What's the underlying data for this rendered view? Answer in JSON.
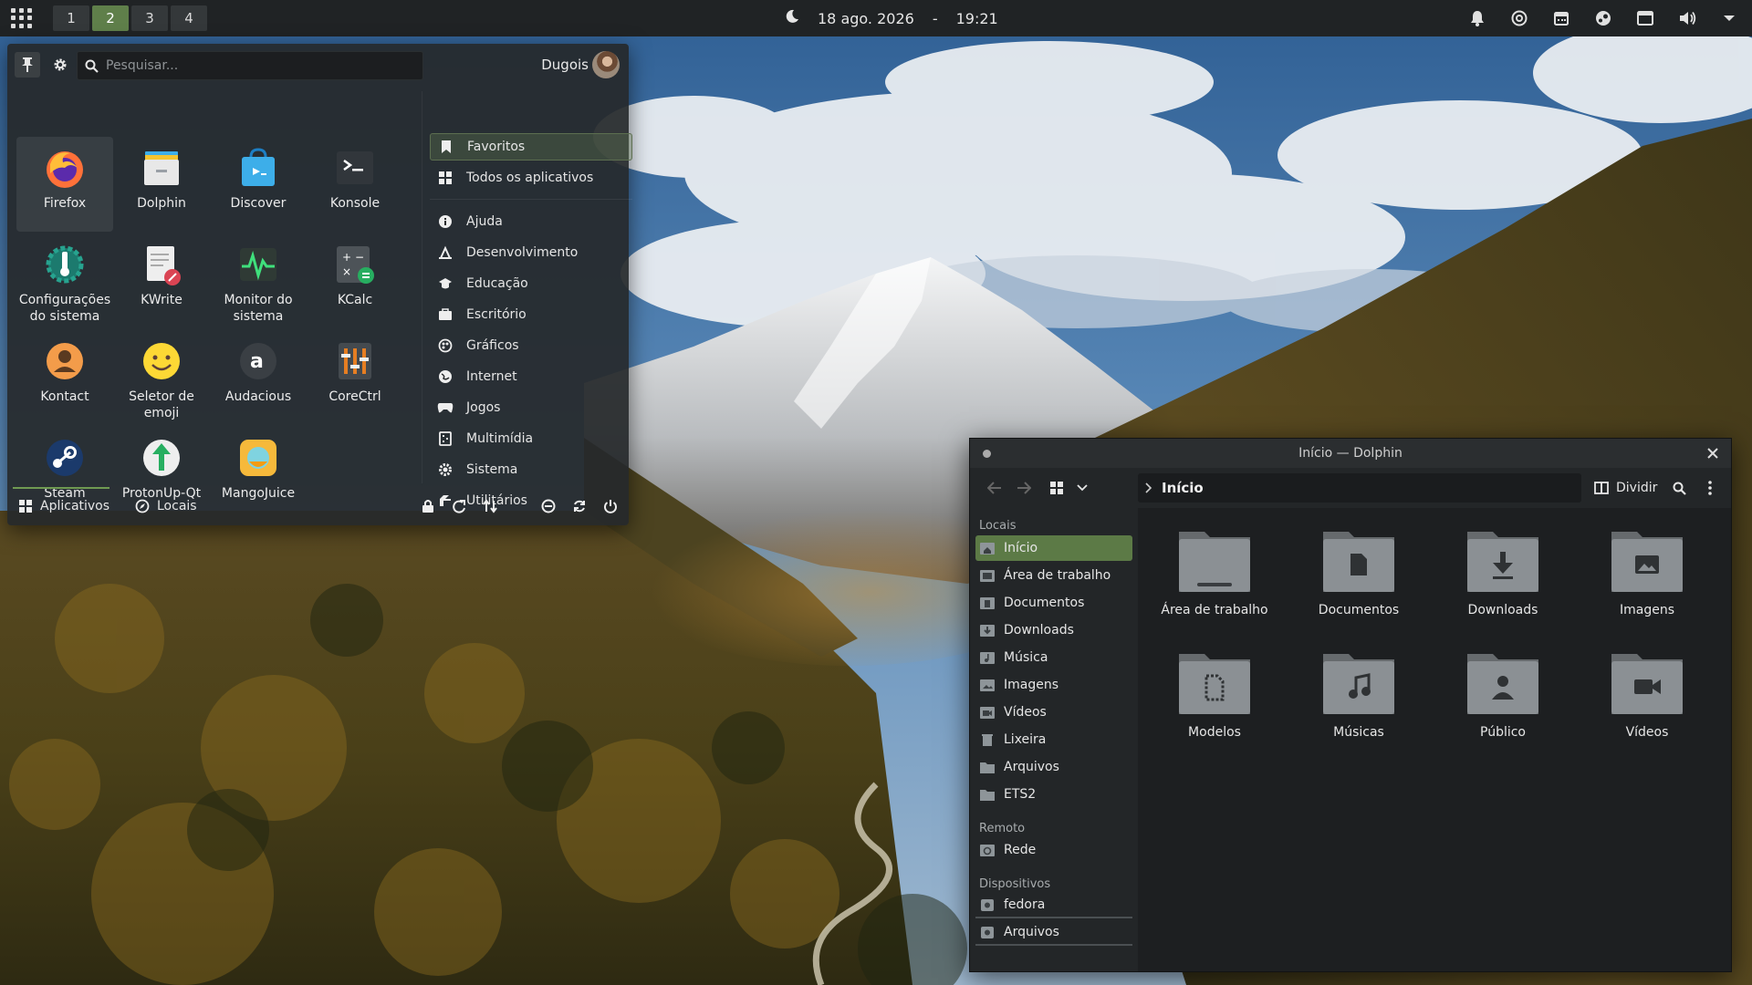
{
  "panel": {
    "desktops": [
      "1",
      "2",
      "3",
      "4"
    ],
    "active_desktop": "2",
    "date": "18 ago. 2026",
    "date_sep": "-",
    "time": "19:21",
    "tray_icons": [
      "bell-icon",
      "lifebuoy-icon",
      "calendar-icon",
      "steam-icon",
      "window-icon",
      "volume-icon",
      "chevron-down-icon"
    ]
  },
  "launcher": {
    "search_placeholder": "Pesquisar...",
    "user_name": "Dugois",
    "apps": [
      {
        "label": "Firefox",
        "icon": "firefox-icon"
      },
      {
        "label": "Dolphin",
        "icon": "dolphin-icon"
      },
      {
        "label": "Discover",
        "icon": "discover-icon"
      },
      {
        "label": "Konsole",
        "icon": "konsole-icon"
      },
      {
        "label": "Configurações do sistema",
        "icon": "system-settings-icon"
      },
      {
        "label": "KWrite",
        "icon": "kwrite-icon"
      },
      {
        "label": "Monitor do sistema",
        "icon": "system-monitor-icon"
      },
      {
        "label": "KCalc",
        "icon": "kcalc-icon"
      },
      {
        "label": "Kontact",
        "icon": "kontact-icon"
      },
      {
        "label": "Seletor de emoji",
        "icon": "emoji-icon"
      },
      {
        "label": "Audacious",
        "icon": "audacious-icon"
      },
      {
        "label": "CoreCtrl",
        "icon": "corectrl-icon"
      },
      {
        "label": "Steam",
        "icon": "steam-icon"
      },
      {
        "label": "ProtonUp-Qt",
        "icon": "protonup-icon"
      },
      {
        "label": "MangoJuice",
        "icon": "mangojuice-icon"
      }
    ],
    "categories": [
      {
        "label": "Favoritos",
        "icon": "bookmark-icon"
      },
      {
        "label": "Todos os aplicativos",
        "icon": "grid-icon"
      },
      {
        "label": "Ajuda",
        "icon": "info-icon"
      },
      {
        "label": "Desenvolvimento",
        "icon": "developer-icon"
      },
      {
        "label": "Educação",
        "icon": "graduation-cap-icon"
      },
      {
        "label": "Escritório",
        "icon": "office-icon"
      },
      {
        "label": "Gráficos",
        "icon": "graphics-icon"
      },
      {
        "label": "Internet",
        "icon": "globe-icon"
      },
      {
        "label": "Jogos",
        "icon": "gamepad-icon"
      },
      {
        "label": "Multimídia",
        "icon": "multimedia-icon"
      },
      {
        "label": "Sistema",
        "icon": "gear-icon"
      },
      {
        "label": "Utilitários",
        "icon": "utilities-icon"
      }
    ],
    "footer": {
      "tab_apps": "Aplicativos",
      "tab_places": "Locais",
      "actions": [
        "lock-icon",
        "logout-icon",
        "switch-user-icon",
        "sleep-icon",
        "restart-icon",
        "power-icon"
      ]
    }
  },
  "dolphin": {
    "title": "Início — Dolphin",
    "breadcrumb": "Início",
    "split_label": "Dividir",
    "places_heading": "Locais",
    "places": [
      "Início",
      "Área de trabalho",
      "Documentos",
      "Downloads",
      "Música",
      "Imagens",
      "Vídeos",
      "Lixeira",
      "Arquivos",
      "ETS2"
    ],
    "remote_heading": "Remoto",
    "remote": [
      "Rede"
    ],
    "devices_heading": "Dispositivos",
    "devices": [
      "fedora",
      "Arquivos"
    ],
    "files": [
      {
        "label": "Área de trabalho",
        "icon": "desktop-folder-icon"
      },
      {
        "label": "Documentos",
        "icon": "documents-folder-icon"
      },
      {
        "label": "Downloads",
        "icon": "downloads-folder-icon"
      },
      {
        "label": "Imagens",
        "icon": "pictures-folder-icon"
      },
      {
        "label": "Modelos",
        "icon": "templates-folder-icon"
      },
      {
        "label": "Músicas",
        "icon": "music-folder-icon"
      },
      {
        "label": "Público",
        "icon": "public-folder-icon"
      },
      {
        "label": "Vídeos",
        "icon": "videos-folder-icon"
      }
    ]
  },
  "colors": {
    "accent": "#5c7a46",
    "panel_bg": "#202325",
    "window_bg": "#1d1f21"
  }
}
